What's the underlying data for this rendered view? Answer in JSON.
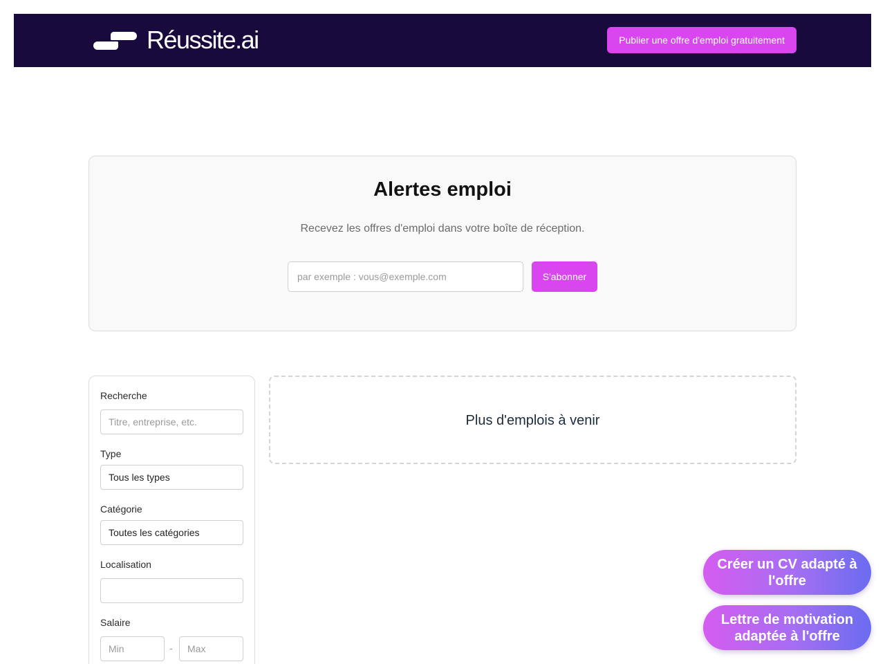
{
  "header": {
    "logo_text": "Réussite.ai",
    "post_job_label": "Publier une offre d'emploi gratuitement"
  },
  "alerts": {
    "title": "Alertes emploi",
    "subtitle": "Recevez les offres d'emploi dans votre boîte de réception.",
    "email_placeholder": "par exemple : vous@exemple.com",
    "email_value": "",
    "subscribe_label": "S'abonner"
  },
  "filters": {
    "search_label": "Recherche",
    "search_placeholder": "Titre, entreprise, etc.",
    "type_label": "Type",
    "type_selected": "Tous les types",
    "category_label": "Catégorie",
    "category_selected": "Toutes les catégories",
    "location_label": "Localisation",
    "location_value": "",
    "salary_label": "Salaire",
    "salary_min_placeholder": "Min",
    "salary_max_placeholder": "Max",
    "salary_separator": "-"
  },
  "jobs": {
    "placeholder_text": "Plus d'emplois à venir"
  },
  "cta": {
    "cv_label": "Créer un CV adapté à l'offre",
    "letter_label": "Lettre de motivation adaptée à l'offre"
  },
  "colors": {
    "header_bg": "#180a3c",
    "accent": "#d946ef",
    "gradient_start": "#d55cf0",
    "gradient_end": "#6a6cf0"
  }
}
